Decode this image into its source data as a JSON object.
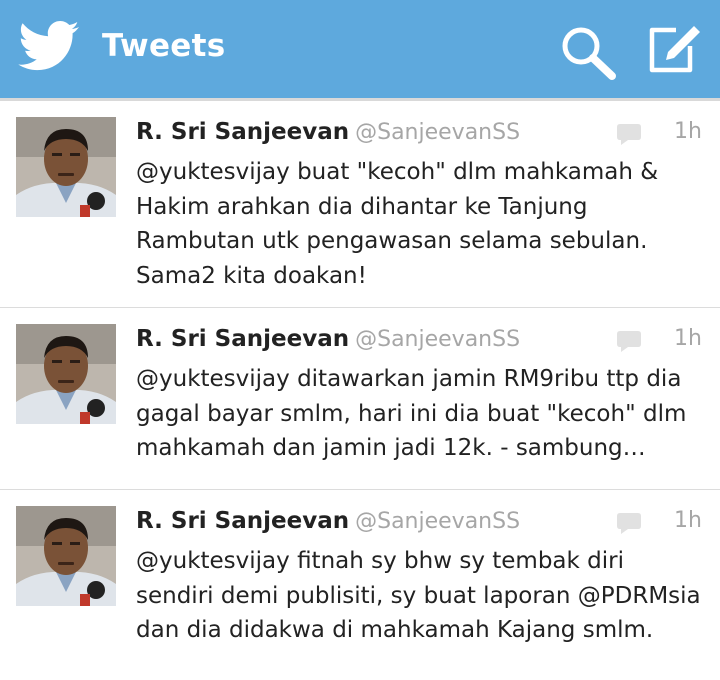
{
  "header": {
    "title": "Tweets",
    "brand_color": "#5ea9dd",
    "logo_icon": "twitter-bird-icon",
    "search_icon": "search-icon",
    "compose_icon": "compose-icon"
  },
  "tweets": [
    {
      "author_name": "R. Sri Sanjeevan",
      "handle": "@SanjeevanSS",
      "time": "1h",
      "text": "@yuktesvijay buat \"kecoh\" dlm mahkamah & Hakim arahkan dia dihantar ke Tanjung Rambutan utk pengawasan selama sebulan. Sama2 kita doakan!"
    },
    {
      "author_name": "R. Sri Sanjeevan",
      "handle": "@SanjeevanSS",
      "time": "1h",
      "text": "@yuktesvijay ditawarkan jamin RM9ribu ttp dia gagal bayar smlm, hari ini dia buat \"kecoh\" dlm mahkamah dan jamin jadi 12k. - sambung…"
    },
    {
      "author_name": "R. Sri Sanjeevan",
      "handle": "@SanjeevanSS",
      "time": "1h",
      "text": "@yuktesvijay fitnah sy bhw sy tembak diri sendiri demi publisiti, sy buat laporan @PDRMsia dan dia didakwa di mahkamah Kajang smlm."
    }
  ]
}
